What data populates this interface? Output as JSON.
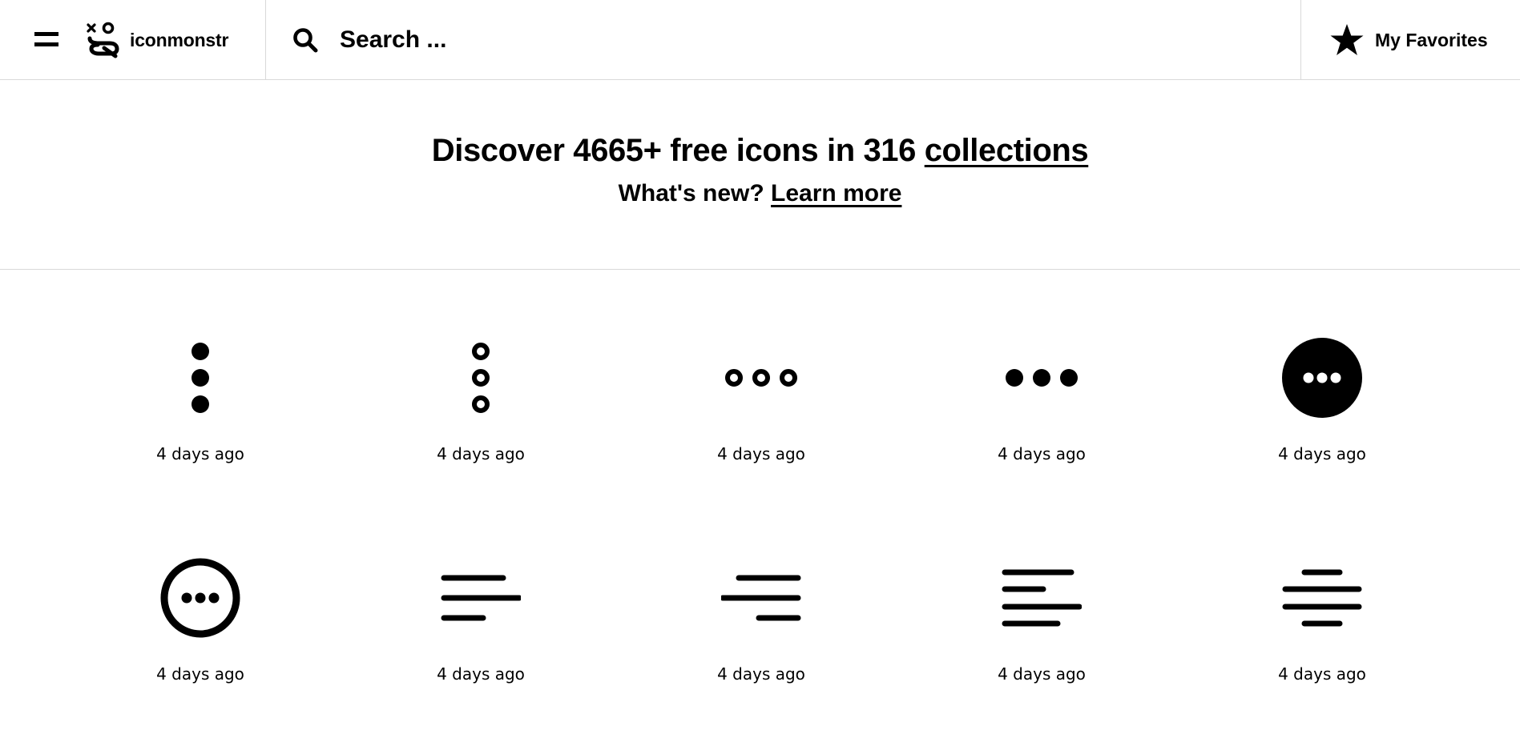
{
  "header": {
    "logo_text": "iconmonstr",
    "search_placeholder": "Search ...",
    "favorites_label": "My Favorites",
    "icons": {
      "menu": "hamburger-menu-icon",
      "logo": "iconmonstr-logo-icon",
      "search": "search-icon",
      "favorites": "star-icon"
    }
  },
  "hero": {
    "title_prefix": "Discover 4665+ free icons in 316 ",
    "title_link": "collections",
    "sub_prefix": "What's new? ",
    "sub_link": "Learn more"
  },
  "icons": [
    {
      "icon": "menu-dots-vertical-filled-icon",
      "age": "4 days ago"
    },
    {
      "icon": "menu-dots-vertical-outline-icon",
      "age": "4 days ago"
    },
    {
      "icon": "menu-dots-horizontal-outline-icon",
      "age": "4 days ago"
    },
    {
      "icon": "menu-dots-horizontal-filled-icon",
      "age": "4 days ago"
    },
    {
      "icon": "menu-dots-circle-filled-icon",
      "age": "4 days ago"
    },
    {
      "icon": "menu-dots-circle-outline-icon",
      "age": "4 days ago"
    },
    {
      "icon": "text-align-left-icon",
      "age": "4 days ago"
    },
    {
      "icon": "text-align-right-icon",
      "age": "4 days ago"
    },
    {
      "icon": "text-align-left-four-lines-icon",
      "age": "4 days ago"
    },
    {
      "icon": "text-align-center-icon",
      "age": "4 days ago"
    }
  ]
}
